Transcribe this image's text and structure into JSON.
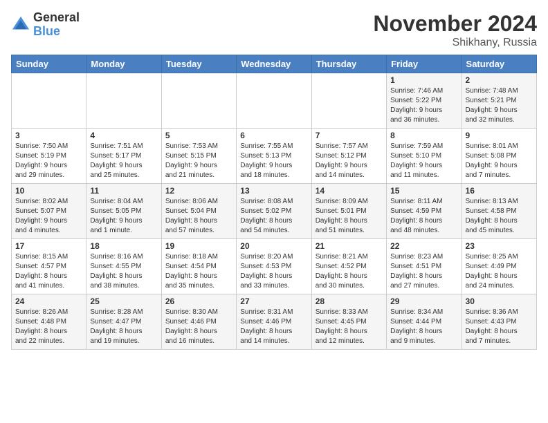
{
  "logo": {
    "general": "General",
    "blue": "Blue"
  },
  "title": "November 2024",
  "location": "Shikhany, Russia",
  "headers": [
    "Sunday",
    "Monday",
    "Tuesday",
    "Wednesday",
    "Thursday",
    "Friday",
    "Saturday"
  ],
  "weeks": [
    [
      {
        "day": "",
        "info": ""
      },
      {
        "day": "",
        "info": ""
      },
      {
        "day": "",
        "info": ""
      },
      {
        "day": "",
        "info": ""
      },
      {
        "day": "",
        "info": ""
      },
      {
        "day": "1",
        "info": "Sunrise: 7:46 AM\nSunset: 5:22 PM\nDaylight: 9 hours\nand 36 minutes."
      },
      {
        "day": "2",
        "info": "Sunrise: 7:48 AM\nSunset: 5:21 PM\nDaylight: 9 hours\nand 32 minutes."
      }
    ],
    [
      {
        "day": "3",
        "info": "Sunrise: 7:50 AM\nSunset: 5:19 PM\nDaylight: 9 hours\nand 29 minutes."
      },
      {
        "day": "4",
        "info": "Sunrise: 7:51 AM\nSunset: 5:17 PM\nDaylight: 9 hours\nand 25 minutes."
      },
      {
        "day": "5",
        "info": "Sunrise: 7:53 AM\nSunset: 5:15 PM\nDaylight: 9 hours\nand 21 minutes."
      },
      {
        "day": "6",
        "info": "Sunrise: 7:55 AM\nSunset: 5:13 PM\nDaylight: 9 hours\nand 18 minutes."
      },
      {
        "day": "7",
        "info": "Sunrise: 7:57 AM\nSunset: 5:12 PM\nDaylight: 9 hours\nand 14 minutes."
      },
      {
        "day": "8",
        "info": "Sunrise: 7:59 AM\nSunset: 5:10 PM\nDaylight: 9 hours\nand 11 minutes."
      },
      {
        "day": "9",
        "info": "Sunrise: 8:01 AM\nSunset: 5:08 PM\nDaylight: 9 hours\nand 7 minutes."
      }
    ],
    [
      {
        "day": "10",
        "info": "Sunrise: 8:02 AM\nSunset: 5:07 PM\nDaylight: 9 hours\nand 4 minutes."
      },
      {
        "day": "11",
        "info": "Sunrise: 8:04 AM\nSunset: 5:05 PM\nDaylight: 9 hours\nand 1 minute."
      },
      {
        "day": "12",
        "info": "Sunrise: 8:06 AM\nSunset: 5:04 PM\nDaylight: 8 hours\nand 57 minutes."
      },
      {
        "day": "13",
        "info": "Sunrise: 8:08 AM\nSunset: 5:02 PM\nDaylight: 8 hours\nand 54 minutes."
      },
      {
        "day": "14",
        "info": "Sunrise: 8:09 AM\nSunset: 5:01 PM\nDaylight: 8 hours\nand 51 minutes."
      },
      {
        "day": "15",
        "info": "Sunrise: 8:11 AM\nSunset: 4:59 PM\nDaylight: 8 hours\nand 48 minutes."
      },
      {
        "day": "16",
        "info": "Sunrise: 8:13 AM\nSunset: 4:58 PM\nDaylight: 8 hours\nand 45 minutes."
      }
    ],
    [
      {
        "day": "17",
        "info": "Sunrise: 8:15 AM\nSunset: 4:57 PM\nDaylight: 8 hours\nand 41 minutes."
      },
      {
        "day": "18",
        "info": "Sunrise: 8:16 AM\nSunset: 4:55 PM\nDaylight: 8 hours\nand 38 minutes."
      },
      {
        "day": "19",
        "info": "Sunrise: 8:18 AM\nSunset: 4:54 PM\nDaylight: 8 hours\nand 35 minutes."
      },
      {
        "day": "20",
        "info": "Sunrise: 8:20 AM\nSunset: 4:53 PM\nDaylight: 8 hours\nand 33 minutes."
      },
      {
        "day": "21",
        "info": "Sunrise: 8:21 AM\nSunset: 4:52 PM\nDaylight: 8 hours\nand 30 minutes."
      },
      {
        "day": "22",
        "info": "Sunrise: 8:23 AM\nSunset: 4:51 PM\nDaylight: 8 hours\nand 27 minutes."
      },
      {
        "day": "23",
        "info": "Sunrise: 8:25 AM\nSunset: 4:49 PM\nDaylight: 8 hours\nand 24 minutes."
      }
    ],
    [
      {
        "day": "24",
        "info": "Sunrise: 8:26 AM\nSunset: 4:48 PM\nDaylight: 8 hours\nand 22 minutes."
      },
      {
        "day": "25",
        "info": "Sunrise: 8:28 AM\nSunset: 4:47 PM\nDaylight: 8 hours\nand 19 minutes."
      },
      {
        "day": "26",
        "info": "Sunrise: 8:30 AM\nSunset: 4:46 PM\nDaylight: 8 hours\nand 16 minutes."
      },
      {
        "day": "27",
        "info": "Sunrise: 8:31 AM\nSunset: 4:46 PM\nDaylight: 8 hours\nand 14 minutes."
      },
      {
        "day": "28",
        "info": "Sunrise: 8:33 AM\nSunset: 4:45 PM\nDaylight: 8 hours\nand 12 minutes."
      },
      {
        "day": "29",
        "info": "Sunrise: 8:34 AM\nSunset: 4:44 PM\nDaylight: 8 hours\nand 9 minutes."
      },
      {
        "day": "30",
        "info": "Sunrise: 8:36 AM\nSunset: 4:43 PM\nDaylight: 8 hours\nand 7 minutes."
      }
    ]
  ]
}
